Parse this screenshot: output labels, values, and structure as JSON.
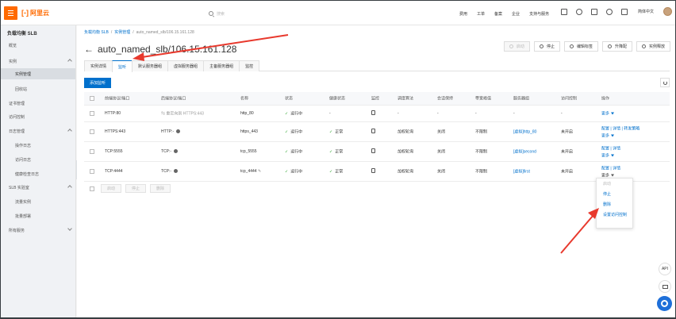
{
  "topbar": {
    "logo_text": "阿里云",
    "search_placeholder": "搜索",
    "nav": [
      "费用",
      "工单",
      "备案",
      "企业",
      "支持与服务"
    ],
    "lang": "简体中文",
    "brand_color": "#ff6a00",
    "icons": [
      "screen-icon",
      "bell-icon",
      "cart-icon",
      "help-icon",
      "home-icon"
    ]
  },
  "sidebar": {
    "title": "负载均衡 SLB",
    "items": [
      {
        "label": "概览",
        "type": "item"
      },
      {
        "label": "实例",
        "type": "group"
      },
      {
        "label": "实例管理",
        "type": "sub",
        "active": true
      },
      {
        "label": "回收站",
        "type": "sub"
      },
      {
        "label": "证书管理",
        "type": "item"
      },
      {
        "label": "访问控制",
        "type": "item"
      },
      {
        "label": "日志管理",
        "type": "group"
      },
      {
        "label": "操作日志",
        "type": "sub"
      },
      {
        "label": "访问日志",
        "type": "sub"
      },
      {
        "label": "健康检查日志",
        "type": "sub"
      },
      {
        "label": "SLB 实验室",
        "type": "group"
      },
      {
        "label": "流量实例",
        "type": "sub"
      },
      {
        "label": "批量部署",
        "type": "sub"
      },
      {
        "label": "所有服务",
        "type": "group-collapsed"
      }
    ]
  },
  "breadcrumb": [
    "负载均衡 SLB",
    "实例管理",
    "auto_named_slb/106.15.161.128"
  ],
  "page_title": "auto_named_slb/106.15.161.128",
  "actions": [
    {
      "label": "启动",
      "disabled": true,
      "icon": "play-icon"
    },
    {
      "label": "停止",
      "disabled": false,
      "icon": "stop-icon"
    },
    {
      "label": "编辑标签",
      "disabled": false,
      "icon": "tag-icon"
    },
    {
      "label": "升降配",
      "disabled": false,
      "icon": "edit-icon"
    },
    {
      "label": "实例释放",
      "disabled": false,
      "icon": "gear-icon"
    }
  ],
  "tabs": [
    {
      "label": "实例详情",
      "active": false
    },
    {
      "label": "监听",
      "active": true
    },
    {
      "label": "默认服务器组",
      "active": false
    },
    {
      "label": "虚拟服务器组",
      "active": false
    },
    {
      "label": "主备服务器组",
      "active": false
    },
    {
      "label": "监控",
      "active": false
    }
  ],
  "add_button": "添加监听",
  "table": {
    "headers": [
      "前端协议/端口",
      "后端协议/端口",
      "名称",
      "状态",
      "健康状态",
      "监控",
      "调度算法",
      "会话保持",
      "带宽峰值",
      "服务器组",
      "访问控制",
      "操作"
    ],
    "rows": [
      {
        "frontend": "HTTP:80",
        "backend": "重定向到 HTTPS:443",
        "name": "http_80",
        "status": "运行中",
        "health": "-",
        "algo": "-",
        "session": "-",
        "bandwidth": "-",
        "group": "-",
        "acl": "-",
        "ops": [
          "更多"
        ]
      },
      {
        "frontend": "HTTPS:443",
        "backend": "HTTP:-",
        "name": "https_443",
        "status": "运行中",
        "health": "正常",
        "algo": "加权轮询",
        "session": "关闭",
        "bandwidth": "不限制",
        "group": "[虚拟]http_80",
        "acl": "未开启",
        "ops": [
          "配置",
          "详情",
          "转发策略",
          "更多"
        ]
      },
      {
        "frontend": "TCP:5555",
        "backend": "TCP:-",
        "name": "tcp_5555",
        "status": "运行中",
        "health": "正常",
        "algo": "加权轮询",
        "session": "关闭",
        "bandwidth": "不限制",
        "group": "[虚拟]second",
        "acl": "未开启",
        "ops": [
          "配置",
          "详情",
          "更多"
        ]
      },
      {
        "frontend": "TCP:4444",
        "backend": "TCP:-",
        "name": "tcp_4444",
        "status": "运行中",
        "health": "正常",
        "algo": "加权轮询",
        "session": "关闭",
        "bandwidth": "不限制",
        "group": "[虚拟]first",
        "acl": "未开启",
        "ops": [
          "配置",
          "详情",
          "更多"
        ]
      }
    ]
  },
  "batch_buttons": [
    "启动",
    "停止",
    "删除"
  ],
  "dropdown": [
    {
      "label": "启动",
      "disabled": true
    },
    {
      "label": "停止",
      "disabled": false
    },
    {
      "label": "删除",
      "disabled": false
    },
    {
      "label": "设置访问控制",
      "disabled": false
    }
  ],
  "fab": {
    "api_label": "API"
  },
  "accent_color": "#0070cc",
  "annotation_color": "#e8392d"
}
